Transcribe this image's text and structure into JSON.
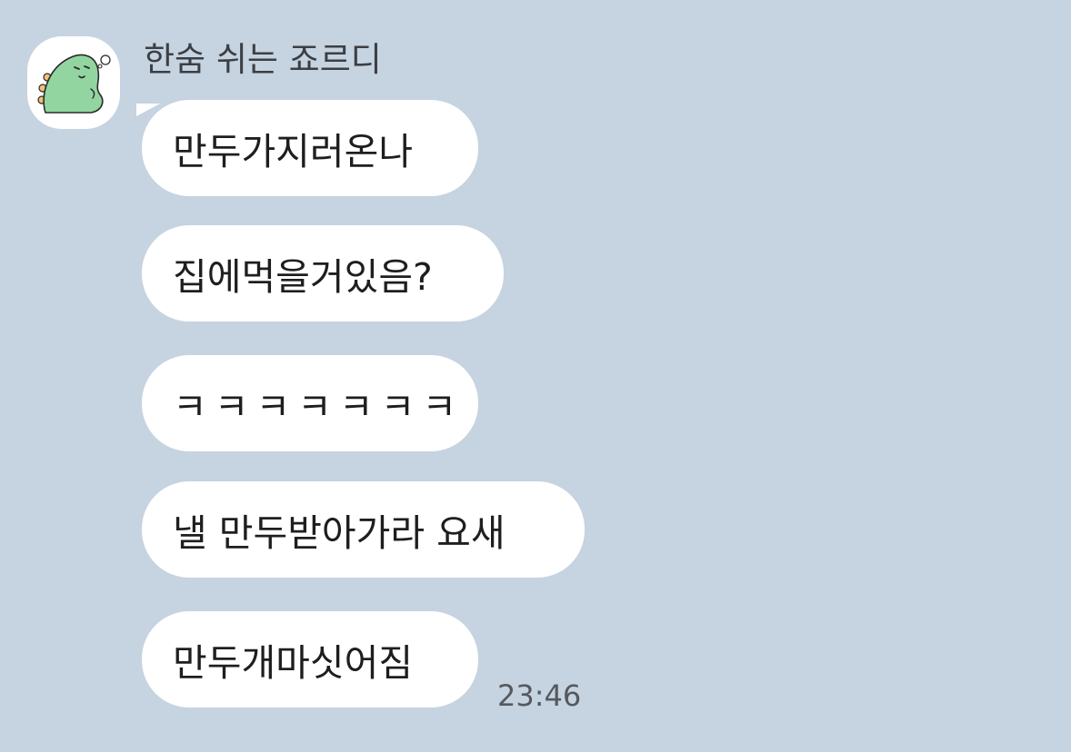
{
  "chat": {
    "sender": {
      "name": "한숨 쉬는 죠르디",
      "avatar_icon": "green-dinosaur-character-icon"
    },
    "messages": [
      {
        "text": "만두가지러온나"
      },
      {
        "text": "집에먹을거있음?"
      },
      {
        "text": "ㅋㅋㅋㅋㅋㅋㅋ"
      },
      {
        "text": "낼 만두받아가라 요새"
      },
      {
        "text": "만두개마싯어짐"
      }
    ],
    "timestamp": "23:46"
  },
  "colors": {
    "background": "#c6d3e0",
    "bubble": "#ffffff",
    "character_green": "#93d5a0"
  }
}
